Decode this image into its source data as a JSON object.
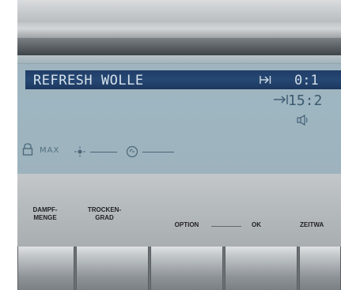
{
  "display": {
    "program_name": "REFRESH WOLLE",
    "remaining_time": "0:1",
    "end_time": "15:2",
    "intensity_label": "MAX"
  },
  "buttons": {
    "steam_amount_label": "DAMPF-\nMENGE",
    "drying_level_label": "TROCKEN-\nGRAD",
    "option_label": "OPTION",
    "ok_label": "OK",
    "time_label": "ZEITWA"
  },
  "icons": {
    "skip": "skip-to-end-icon",
    "end_arrow": "arrow-right-to-bar-icon",
    "sound": "speaker-icon",
    "lock": "lock-icon",
    "sun": "sun-icon",
    "clock": "clock-icon"
  },
  "colors": {
    "lcd_background": "#9eb6c1",
    "lcd_highlight": "#22426c",
    "lcd_text_dark": "#3c5a70"
  }
}
